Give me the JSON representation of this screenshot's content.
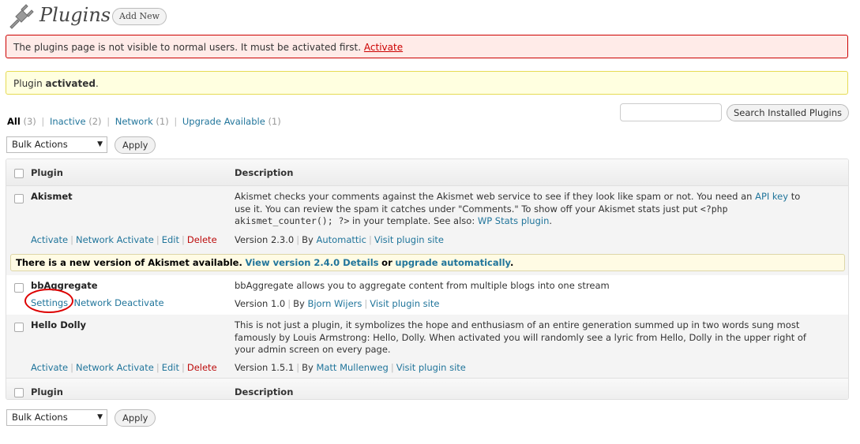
{
  "header": {
    "title": "Plugins",
    "add_new": "Add New"
  },
  "notices": {
    "error_text": "The plugins page is not visible to normal users. It must be activated first.",
    "error_link": "Activate",
    "updated_pre": "Plugin ",
    "updated_bold": "activated",
    "updated_post": "."
  },
  "filters": [
    {
      "label": "All",
      "count": "(3)"
    },
    {
      "label": "Inactive",
      "count": "(2)"
    },
    {
      "label": "Network",
      "count": "(1)"
    },
    {
      "label": "Upgrade Available",
      "count": "(1)"
    }
  ],
  "search": {
    "button": "Search Installed Plugins",
    "value": ""
  },
  "bulk": {
    "selected": "Bulk Actions",
    "apply": "Apply"
  },
  "table": {
    "col_plugin": "Plugin",
    "col_description": "Description"
  },
  "plugins": [
    {
      "name": "Akismet",
      "actions": {
        "a1": "Activate",
        "a2": "Network Activate",
        "a3": "Edit",
        "a4": "Delete"
      },
      "desc": {
        "p1": "Akismet checks your comments against the Akismet web service to see if they look like spam or not. You need an ",
        "link1": "API key",
        "p2": " to use it. You can review the spam it catches under \"Comments.\" To show off your Akismet stats just put ",
        "code": "<?php akismet_counter(); ?>",
        "p3": " in your template. See also: ",
        "link2": "WP Stats plugin",
        "p4": "."
      },
      "meta": {
        "version": "Version 2.3.0",
        "by": "By",
        "author": "Automattic",
        "site": "Visit plugin site"
      },
      "update": {
        "text1": "There is a new version of Akismet available.",
        "link1": "View version 2.4.0 Details",
        "text2": "or",
        "link2": "upgrade automatically",
        "text3": "."
      }
    },
    {
      "name": "bbAggregate",
      "actions": {
        "a1": "Settings",
        "a2": "Network Deactivate"
      },
      "desc": {
        "p1": "bbAggregate allows you to aggregate content from multiple blogs into one stream"
      },
      "meta": {
        "version": "Version 1.0",
        "by": "By",
        "author": "Bjorn Wijers",
        "site": "Visit plugin site"
      }
    },
    {
      "name": "Hello Dolly",
      "actions": {
        "a1": "Activate",
        "a2": "Network Activate",
        "a3": "Edit",
        "a4": "Delete"
      },
      "desc": {
        "p1": "This is not just a plugin, it symbolizes the hope and enthusiasm of an entire generation summed up in two words sung most famously by Louis Armstrong: Hello, Dolly. When activated you will randomly see a lyric from Hello, Dolly in the upper right of your admin screen on every page."
      },
      "meta": {
        "version": "Version 1.5.1",
        "by": "By",
        "author": "Matt Mullenweg",
        "site": "Visit plugin site"
      }
    }
  ],
  "colors": {
    "link": "#21759b",
    "delete": "#bc0b0b",
    "error_bg": "#ffebe8",
    "updated_bg": "#ffffe0",
    "highlight_circle": "#dd0000"
  },
  "icons": {
    "header": "plugin-plug-icon",
    "select": "dropdown-arrow-icon"
  }
}
